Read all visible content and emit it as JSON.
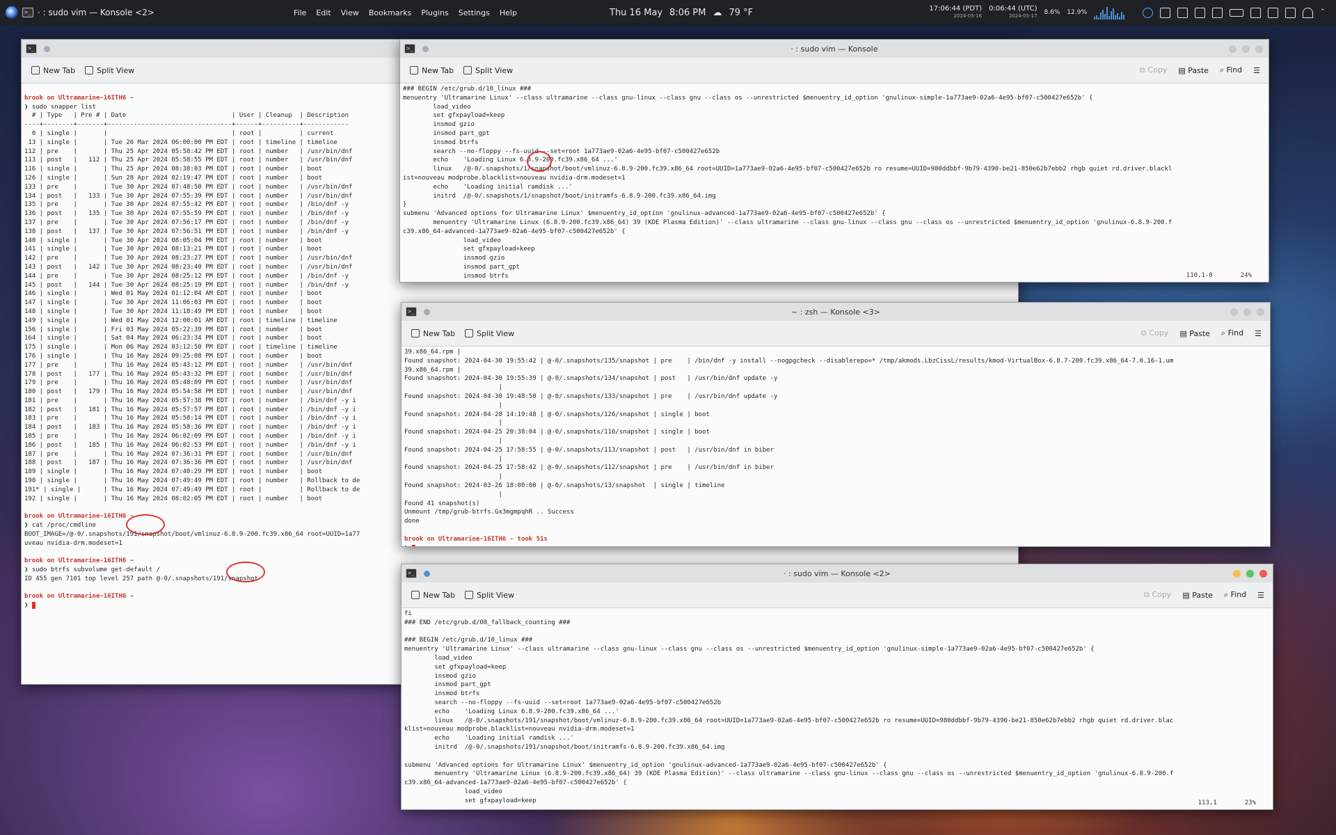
{
  "panel": {
    "app_title": "· : sudo vim — Konsole <2>",
    "menus": [
      "File",
      "Edit",
      "View",
      "Bookmarks",
      "Plugins",
      "Settings",
      "Help"
    ],
    "date": "Thu 16 May",
    "time": "8:06 PM",
    "weather": "79 °F",
    "tz1_time": "17:06:44",
    "tz1_label": "(PDT)",
    "tz1_date": "2024-05-16",
    "tz2_time": "0:06:44",
    "tz2_label": "(UTC)",
    "tz2_date": "2024-05-17",
    "cpu": "8.6%",
    "mem": "12.9%"
  },
  "win1": {
    "title": "",
    "new_tab": "New Tab",
    "split_view": "Split View",
    "lines": [
      "",
      "brook on Ultramarine-16ITH6 ~",
      "❯ sudo snapper list",
      "  # | Type   | Pre # | Date                            | User | Cleanup  | Description",
      "----+--------+-------+---------------------------------+------+----------+------------",
      "  0 | single |       |                                 | root |          | current",
      " 13 | single |       | Tue 26 Mar 2024 06:00:00 PM EDT | root | timeline | timeline",
      "112 | pre    |       | Thu 25 Apr 2024 05:58:42 PM EDT | root | number   | /usr/bin/dnf",
      "113 | post   |   112 | Thu 25 Apr 2024 05:58:55 PM EDT | root | number   | /usr/bin/dnf",
      "116 | single |       | Thu 25 Apr 2024 08:38:03 PM EDT | root | number   | boot",
      "126 | single |       | Sun 28 Apr 2024 02:19:47 PM EDT | root | number   | boot",
      "133 | pre    |       | Tue 30 Apr 2024 07:48:50 PM EDT | root | number   | /usr/bin/dnf",
      "134 | post   |   133 | Tue 30 Apr 2024 07:55:39 PM EDT | root | number   | /usr/bin/dnf",
      "135 | pre    |       | Tue 30 Apr 2024 07:55:42 PM EDT | root | number   | /bin/dnf -y",
      "136 | post   |   135 | Tue 30 Apr 2024 07:55:59 PM EDT | root | number   | /bin/dnf -y",
      "137 | pre    |       | Tue 30 Apr 2024 07:56:17 PM EDT | root | number   | /bin/dnf -y",
      "138 | post   |   137 | Tue 30 Apr 2024 07:56:51 PM EDT | root | number   | /bin/dnf -y",
      "140 | single |       | Tue 30 Apr 2024 08:05:04 PM EDT | root | number   | boot",
      "141 | single |       | Tue 30 Apr 2024 08:13:21 PM EDT | root | number   | boot",
      "142 | pre    |       | Tue 30 Apr 2024 08:23:27 PM EDT | root | number   | /usr/bin/dnf",
      "143 | post   |   142 | Tue 30 Apr 2024 08:23:40 PM EDT | root | number   | /usr/bin/dnf",
      "144 | pre    |       | Tue 30 Apr 2024 08:25:12 PM EDT | root | number   | /bin/dnf -y",
      "145 | post   |   144 | Tue 30 Apr 2024 08:25:19 PM EDT | root | number   | /bin/dnf -y",
      "146 | single |       | Wed 01 May 2024 01:12:04 AM EDT | root | number   | boot",
      "147 | single |       | Tue 30 Apr 2024 11:06:03 PM EDT | root | number   | boot",
      "148 | single |       | Tue 30 Apr 2024 11:18:49 PM EDT | root | number   | boot",
      "149 | single |       | Wed 01 May 2024 12:00:01 AM EDT | root | timeline | timeline",
      "156 | single |       | Fri 03 May 2024 05:22:39 PM EDT | root | number   | boot",
      "164 | single |       | Sat 04 May 2024 06:23:34 PM EDT | root | number   | boot",
      "175 | single |       | Mon 06 May 2024 03:12:50 PM EDT | root | timeline | timeline",
      "176 | single |       | Thu 16 May 2024 09:25:08 PM EDT | root | number   | boot",
      "177 | pre    |       | Thu 16 May 2024 05:43:12 PM EDT | root | number   | /usr/bin/dnf",
      "178 | post   |   177 | Thu 16 May 2024 05:43:32 PM EDT | root | number   | /usr/bin/dnf",
      "179 | pre    |       | Thu 16 May 2024 05:48:09 PM EDT | root | number   | /usr/bin/dnf",
      "180 | post   |   179 | Thu 16 May 2024 05:54:58 PM EDT | root | number   | /usr/bin/dnf",
      "181 | pre    |       | Thu 16 May 2024 05:57:38 PM EDT | root | number   | /bin/dnf -y i",
      "182 | post   |   181 | Thu 16 May 2024 05:57:57 PM EDT | root | number   | /bin/dnf -y i",
      "183 | pre    |       | Thu 16 May 2024 05:58:14 PM EDT | root | number   | /bin/dnf -y i",
      "184 | post   |   183 | Thu 16 May 2024 05:58:36 PM EDT | root | number   | /bin/dnf -y i",
      "185 | pre    |       | Thu 16 May 2024 06:02:09 PM EDT | root | number   | /bin/dnf -y i",
      "186 | post   |   185 | Thu 16 May 2024 06:02:53 PM EDT | root | number   | /bin/dnf -y i",
      "187 | pre    |       | Thu 16 May 2024 07:36:31 PM EDT | root | number   | /usr/bin/dnf",
      "188 | post   |   187 | Thu 16 May 2024 07:36:36 PM EDT | root | number   | /usr/bin/dnf",
      "189 | single |       | Thu 16 May 2024 07:40:29 PM EDT | root | number   | boot",
      "190 | single |       | Thu 16 May 2024 07:49:49 PM EDT | root | number   | Rollback to de",
      "191* | single |      | Thu 16 May 2024 07:49:49 PM EDT | root |          | Rollback to de",
      "192 | single |       | Thu 16 May 2024 08:02:05 PM EDT | root | number   | boot",
      "",
      "brook on Ultramarine-16ITH6 ~",
      "❯ cat /proc/cmdline",
      "BOOT_IMAGE=/@-0/.snapshots/191/snapshot/boot/vmlinuz-6.8.9-200.fc39.x86_64 root=UUID=1a77",
      "uveau nvidia-drm.modeset=1",
      "",
      "brook on Ultramarine-16ITH6 ~",
      "❯ sudo btrfs subvolume get-default /",
      "ID 455 gen 7101 top level 257 path @-0/.snapshots/191/snapshot",
      "",
      "brook on Ultramarine-16ITH6 ~",
      "❯ "
    ]
  },
  "win2": {
    "title": "· : sudo vim — Konsole",
    "new_tab": "New Tab",
    "split_view": "Split View",
    "copy": "Copy",
    "paste": "Paste",
    "find": "Find",
    "status_pos": "110,1-8",
    "status_pct": "24%",
    "lines": [
      "### BEGIN /etc/grub.d/10_linux ###",
      "menuentry 'Ultramarine Linux' --class ultramarine --class gnu-linux --class gnu --class os --unrestricted $menuentry_id_option 'gnulinux-simple-1a773ae9-02a6-4e95-bf07-c500427e652b' {",
      "        load_video",
      "        set gfxpayload=keep",
      "        insmod gzio",
      "        insmod part_gpt",
      "        insmod btrfs",
      "        search --no-floppy --fs-uuid --set=root 1a773ae9-02a6-4e95-bf07-c500427e652b",
      "        echo    'Loading Linux 6.8.9-200.fc39.x86_64 ...'",
      "        linux   /@-0/.snapshots/1/snapshot/boot/vmlinuz-6.8.9-200.fc39.x86_64 root=UUID=1a773ae9-02a6-4e95-bf07-c500427e652b ro resume=UUID=980ddbbf-9b79-4390-be21-850e62b7ebb2 rhgb quiet rd.driver.blackl",
      "ist=nouveau modprobe.blacklist=nouveau nvidia-drm.modeset=1",
      "        echo    'Loading initial ramdisk ...'",
      "        initrd  /@-0/.snapshots/1/snapshot/boot/initramfs-6.8.9-200.fc39.x86_64.img",
      "}",
      "submenu 'Advanced options for Ultramarine Linux' $menuentry_id_option 'gnulinux-advanced-1a773ae9-02a6-4e95-bf07-c500427e652b' {",
      "        menuentry 'Ultramarine Linux (6.8.9-200.fc39.x86_64) 39 (KDE Plasma Edition)' --class ultramarine --class gnu-linux --class gnu --class os --unrestricted $menuentry_id_option 'gnulinux-6.8.9-200.f",
      "c39.x86_64-advanced-1a773ae9-02a6-4e95-bf07-c500427e652b' {",
      "                load_video",
      "                set gfxpayload=keep",
      "                insmod gzio",
      "                insmod part_gpt",
      "                insmod btrfs"
    ]
  },
  "win3": {
    "title": "~ : zsh — Konsole <3>",
    "new_tab": "New Tab",
    "split_view": "Split View",
    "copy": "Copy",
    "paste": "Paste",
    "find": "Find",
    "lines": [
      "39.x86_64.rpm |",
      "Found snapshot: 2024-04-30 19:55:42 | @-0/.snapshots/135/snapshot | pre    | /bin/dnf -y install --nogpgcheck --disablerepo=* /tmp/akmods.LbzCissL/results/kmod-VirtualBox-6.8.7-200.fc39.x86_64-7.0.16-1.um",
      "39.x86_64.rpm |",
      "Found snapshot: 2024-04-30 19:55:39 | @-0/.snapshots/134/snapshot | post   | /usr/bin/dnf update -y",
      "                         |",
      "Found snapshot: 2024-04-30 19:48:50 | @-0/.snapshots/133/snapshot | pre    | /usr/bin/dnf update -y",
      "                         |",
      "Found snapshot: 2024-04-28 14:19:48 | @-0/.snapshots/126/snapshot | single | boot",
      "                         |",
      "Found snapshot: 2024-04-25 20:38:04 | @-0/.snapshots/116/snapshot | single | boot",
      "                         |",
      "Found snapshot: 2024-04-25 17:58:55 | @-0/.snapshots/113/snapshot | post   | /usr/bin/dnf in biber",
      "                         |",
      "Found snapshot: 2024-04-25 17:58:42 | @-0/.snapshots/112/snapshot | pre    | /usr/bin/dnf in biber",
      "                         |",
      "Found snapshot: 2024-03-26 18:00:00 | @-0/.snapshots/13/snapshot  | single | timeline",
      "                         |",
      "Found 41 snapshot(s)",
      "Unmount /tmp/grub-btrfs.Gx3mgmpqhR .. Success",
      "done",
      "",
      "brook on Ultramarine-16ITH6 - took 51s",
      "❯ "
    ]
  },
  "win4": {
    "title": "· : sudo vim — Konsole <2>",
    "new_tab": "New Tab",
    "split_view": "Split View",
    "copy": "Copy",
    "paste": "Paste",
    "find": "Find",
    "status_pos": "113,1",
    "status_pct": "23%",
    "lines": [
      "fi",
      "### END /etc/grub.d/08_fallback_counting ###",
      "",
      "### BEGIN /etc/grub.d/10_linux ###",
      "menuentry 'Ultramarine Linux' --class ultramarine --class gnu-linux --class gnu --class os --unrestricted $menuentry_id_option 'gnulinux-simple-1a773ae9-02a6-4e95-bf07-c500427e652b' {",
      "        load_video",
      "        set gfxpayload=keep",
      "        insmod gzio",
      "        insmod part_gpt",
      "        insmod btrfs",
      "        search --no-floppy --fs-uuid --set=root 1a773ae9-02a6-4e95-bf07-c500427e652b",
      "        echo    'Loading Linux 6.8.9-200.fc39.x86_64 ...'",
      "        linux   /@-0/.snapshots/191/snapshot/boot/vmlinuz-6.8.9-200.fc39.x86_64 root=UUID=1a773ae9-02a6-4e95-bf07-c500427e652b ro resume=UUID=980ddbbf-9b79-4390-be21-850e62b7ebb2 rhgb quiet rd.driver.blac",
      "klist=nouveau modprobe.blacklist=nouveau nvidia-drm.modeset=1",
      "        echo    'Loading initial ramdisk ...'",
      "        initrd  /@-0/.snapshots/191/snapshot/boot/initramfs-6.8.9-200.fc39.x86_64.img",
      "",
      "submenu 'Advanced options for Ultramarine Linux' $menuentry_id_option 'gnulinux-advanced-1a773ae9-02a6-4e95-bf07-c500427e652b' {",
      "        menuentry 'Ultramarine Linux (6.8.9-200.fc39.x86_64) 39 (KDE Plasma Edition)' --class ultramarine --class gnu-linux --class gnu --class os --unrestricted $menuentry_id_option 'gnulinux-6.8.9-200.f",
      "c39.x86_64-advanced-1a773ae9-02a6-4e95-bf07-c500427e652b' {",
      "                load_video",
      "                set gfxpayload=keep"
    ]
  }
}
